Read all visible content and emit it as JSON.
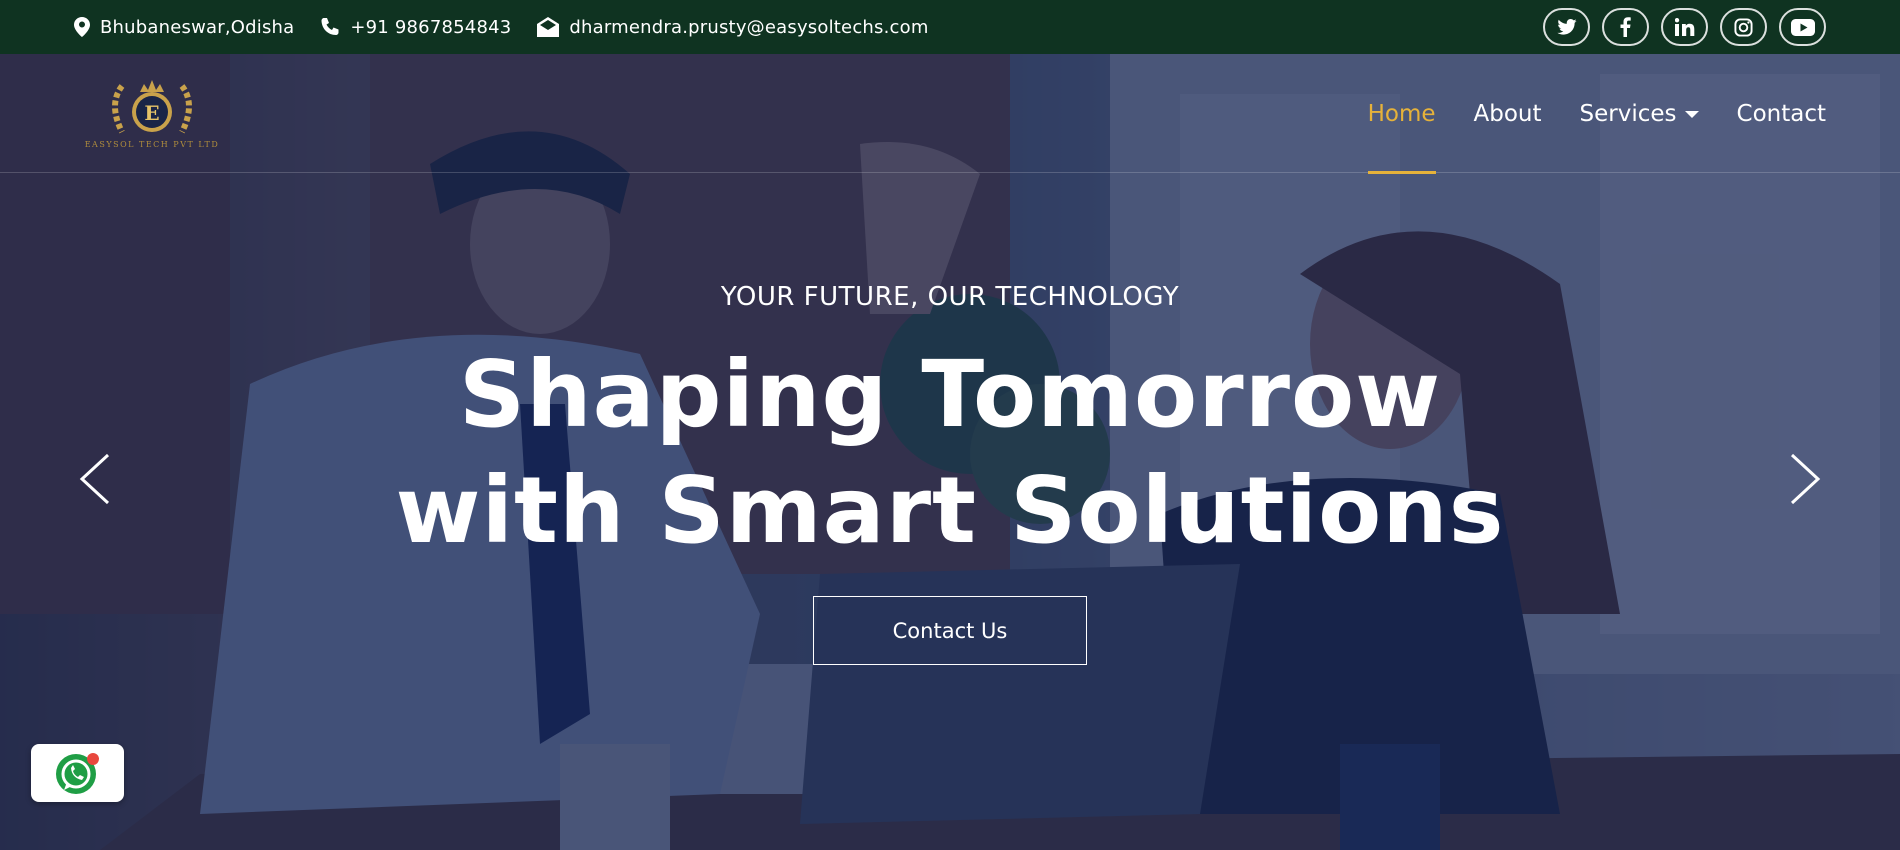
{
  "topbar": {
    "location": "Bhubaneswar,Odisha",
    "phone": "+91 9867854843",
    "email": "dharmendra.prusty@easysoltechs.com",
    "socials": [
      "twitter-icon",
      "facebook-icon",
      "linkedin-icon",
      "instagram-icon",
      "youtube-icon"
    ]
  },
  "logo": {
    "letter": "E",
    "text": "EASYSOL TECH PVT LTD"
  },
  "nav": {
    "items": [
      {
        "label": "Home",
        "active": true
      },
      {
        "label": "About"
      },
      {
        "label": "Services",
        "dropdown": true
      },
      {
        "label": "Contact"
      }
    ]
  },
  "hero": {
    "eyebrow": "YOUR FUTURE, OUR TECHNOLOGY",
    "line1": "Shaping Tomorrow",
    "line2": "with Smart Solutions",
    "cta": "Contact Us"
  },
  "colors": {
    "topbar": "#0f3321",
    "accent": "#e6b23a",
    "overlay": "#122150",
    "gold": "#b08d3c"
  }
}
